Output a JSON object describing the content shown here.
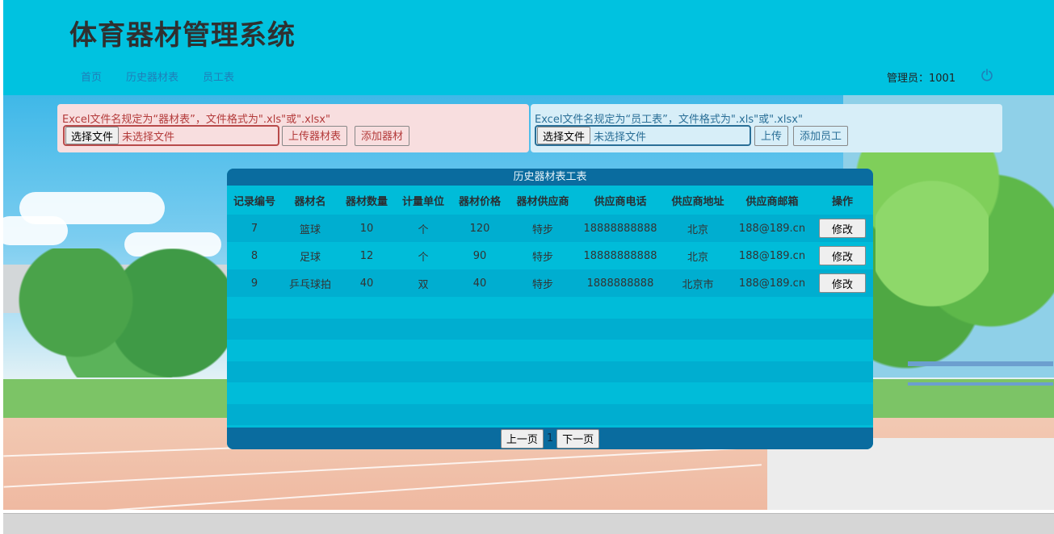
{
  "app": {
    "title": "体育器材管理系统"
  },
  "nav": {
    "items": [
      "首页",
      "历史器材表",
      "员工表"
    ]
  },
  "admin": {
    "label": "管理员：1001"
  },
  "equip_upload": {
    "rule": "Excel文件名规定为“器材表”，文件格式为\".xls\"或\".xlsx\"",
    "choose_label": "选择文件",
    "status": "未选择文件",
    "upload_label": "上传器材表",
    "add_label": "添加器材"
  },
  "staff_upload": {
    "rule": "Excel文件名规定为“员工表”，文件格式为\".xls\"或\".xlsx\"",
    "choose_label": "选择文件",
    "status": "未选择文件",
    "upload_label": "上传",
    "add_label": "添加员工"
  },
  "table": {
    "title": "历史器材表工表",
    "columns": [
      "记录编号",
      "器材名",
      "器材数量",
      "计量单位",
      "器材价格",
      "器材供应商",
      "供应商电话",
      "供应商地址",
      "供应商邮箱",
      "操作"
    ],
    "rows": [
      [
        "7",
        "篮球",
        "10",
        "个",
        "120",
        "特步",
        "18888888888",
        "北京",
        "188@189.cn",
        "修改"
      ],
      [
        "8",
        "足球",
        "12",
        "个",
        "90",
        "特步",
        "18888888888",
        "北京",
        "188@189.cn",
        "修改"
      ],
      [
        "9",
        "乒乓球拍",
        "40",
        "双",
        "40",
        "特步",
        "1888888888",
        "北京市",
        "188@189.cn",
        "修改"
      ]
    ]
  },
  "pager": {
    "prev": "上一页",
    "page": "1",
    "next": "下一页"
  },
  "colors": {
    "header_bg": "#00c2e0",
    "table_header_bg": "#0a6c9f"
  },
  "icons": {
    "power": "power-icon"
  }
}
